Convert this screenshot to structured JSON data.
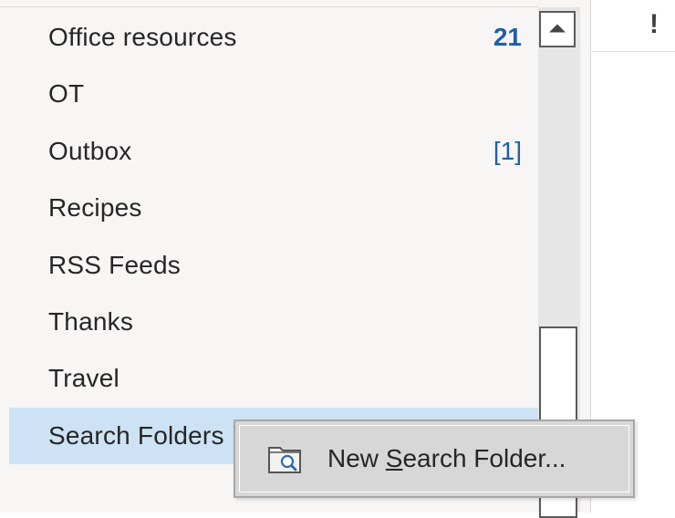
{
  "folders": [
    {
      "label": "Office resources",
      "count": "21",
      "count_style": "bold-unread"
    },
    {
      "label": "OT",
      "count": ""
    },
    {
      "label": "Outbox",
      "count": "[1]",
      "count_style": "outbox"
    },
    {
      "label": "Recipes",
      "count": ""
    },
    {
      "label": "RSS Feeds",
      "count": ""
    },
    {
      "label": "Thanks",
      "count": ""
    },
    {
      "label": "Travel",
      "count": ""
    },
    {
      "label": "Search Folders",
      "count": "",
      "selected": true
    }
  ],
  "right_pane": {
    "importance_header": "!"
  },
  "context_menu": {
    "items": [
      {
        "label_before": "New ",
        "accelerator": "S",
        "label_after": "earch Folder...",
        "icon": "search-folder-icon"
      }
    ]
  },
  "colors": {
    "pane_background": "#f7f6f5",
    "selection": "#cde3f5",
    "count_blue": "#1f5fa8",
    "menu_background": "#d7d7d7"
  }
}
